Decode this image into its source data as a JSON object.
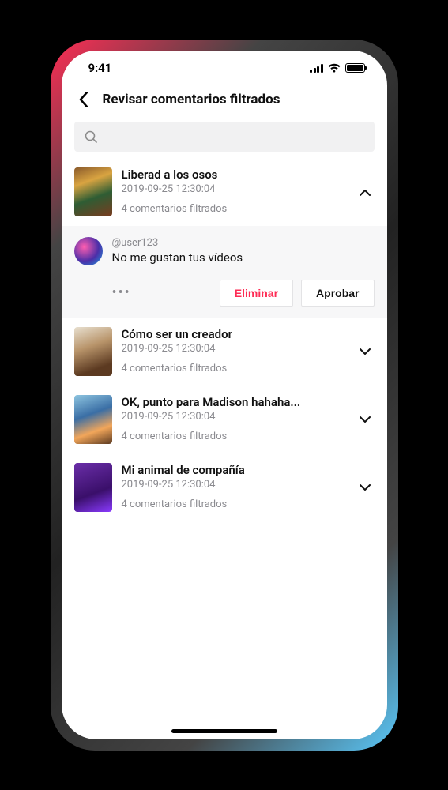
{
  "status": {
    "time": "9:41"
  },
  "header": {
    "title": "Revisar comentarios filtrados"
  },
  "search": {
    "placeholder": ""
  },
  "videos": [
    {
      "title": "Liberad a los osos",
      "date": "2019-09-25 12:30:04",
      "count": "4 comentarios filtrados",
      "expanded": true
    },
    {
      "title": "Cómo ser un creador",
      "date": "2019-09-25 12:30:04",
      "count": "4 comentarios filtrados",
      "expanded": false
    },
    {
      "title": "OK, punto para Madison hahaha...",
      "date": "2019-09-25 12:30:04",
      "count": "4 comentarios filtrados",
      "expanded": false
    },
    {
      "title": "Mi animal de compañía",
      "date": "2019-09-25 12:30:04",
      "count": "4 comentarios filtrados",
      "expanded": false
    }
  ],
  "comment": {
    "user": "@user123",
    "text": "No me gustan tus vídeos",
    "delete_label": "Eliminar",
    "approve_label": "Aprobar"
  }
}
